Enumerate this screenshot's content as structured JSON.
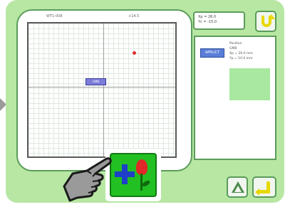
{
  "canvas": {
    "header_left": "WT1-008",
    "header_right": "+14.5"
  },
  "coordinates": {
    "x_line": "Xp = 26.0",
    "y_line": "Yc = -15.0"
  },
  "motif_label": "GMB",
  "list": {
    "selected_label": "APPLICT",
    "info_lines": [
      "Position",
      "GMB",
      "Xp = 26.0 mm",
      "Yp = 10.0 mm"
    ]
  },
  "icons": {
    "undo": "undo-arrow-icon",
    "scroll_up": "triangle-up-icon",
    "enter": "enter-arrow-icon",
    "add": "add-motif-icon",
    "pointer": "pointing-hand-icon"
  },
  "colors": {
    "screen_bg": "#b7e7a3",
    "frame": "#5a9c5a",
    "accent_yellow": "#e8d800",
    "add_button": "#22c022",
    "plus": "#1e3fc8",
    "tulip": "#e02828",
    "selection": "#5a7ed8"
  }
}
